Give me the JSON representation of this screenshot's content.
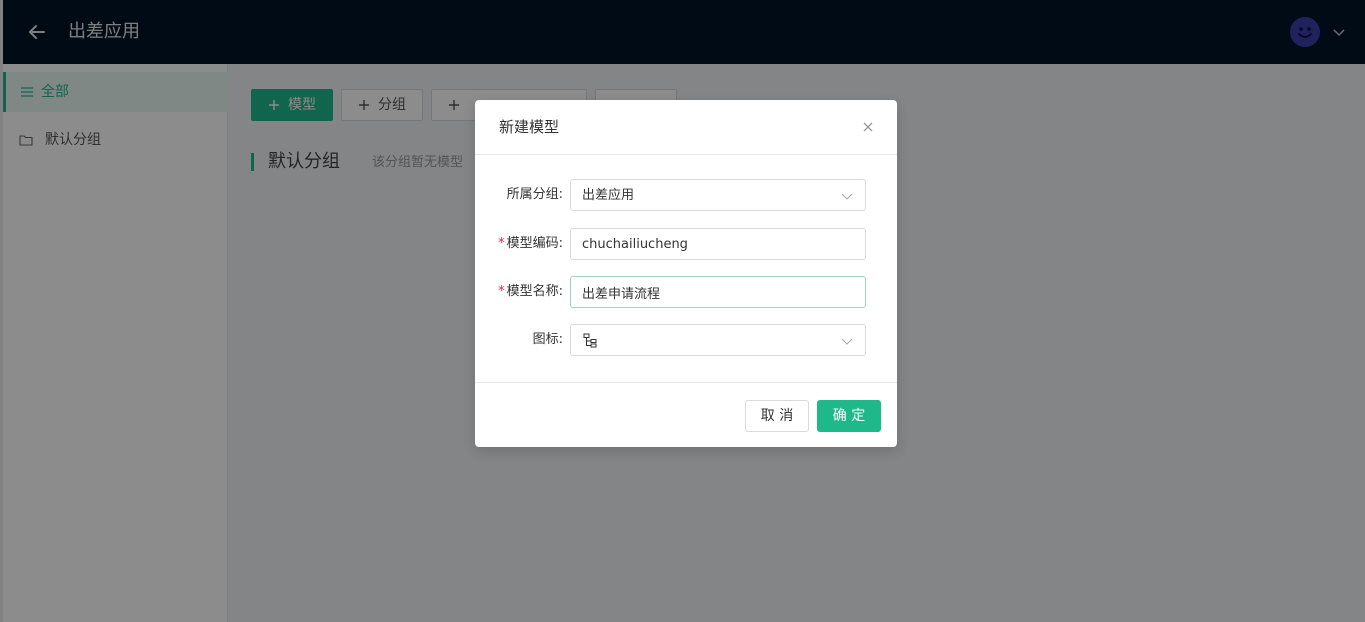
{
  "header": {
    "title": "出差应用",
    "back_icon": "arrow-left-icon",
    "avatar_icon": "smiley-avatar-icon"
  },
  "sidebar": {
    "items": [
      {
        "label": "全部",
        "icon": "list-icon",
        "active": true
      },
      {
        "label": "默认分组",
        "icon": "folder-icon",
        "active": false
      }
    ]
  },
  "toolbar": {
    "buttons": [
      {
        "label": "模型",
        "icon": "plus-icon"
      },
      {
        "label": "分组",
        "icon": "plus-icon"
      },
      {
        "label": "",
        "icon": "plus-icon"
      },
      {
        "label": "",
        "icon": ""
      }
    ]
  },
  "group": {
    "title": "默认分组",
    "empty_text": "该分组暂无模型"
  },
  "modal": {
    "title": "新建模型",
    "fields": {
      "group": {
        "label": "所属分组:",
        "value": "出差应用"
      },
      "code": {
        "label": "模型编码:",
        "value": "chuchailiucheng",
        "required": true
      },
      "name": {
        "label": "模型名称:",
        "value": "出差申请流程",
        "required": true
      },
      "icon": {
        "label": "图标:",
        "value_icon": "tree-structure-icon"
      }
    },
    "cancel_label": "取 消",
    "ok_label": "确 定"
  },
  "colors": {
    "header_bg": "#001529",
    "accent": "#1fb88a",
    "required": "#f5222d"
  }
}
